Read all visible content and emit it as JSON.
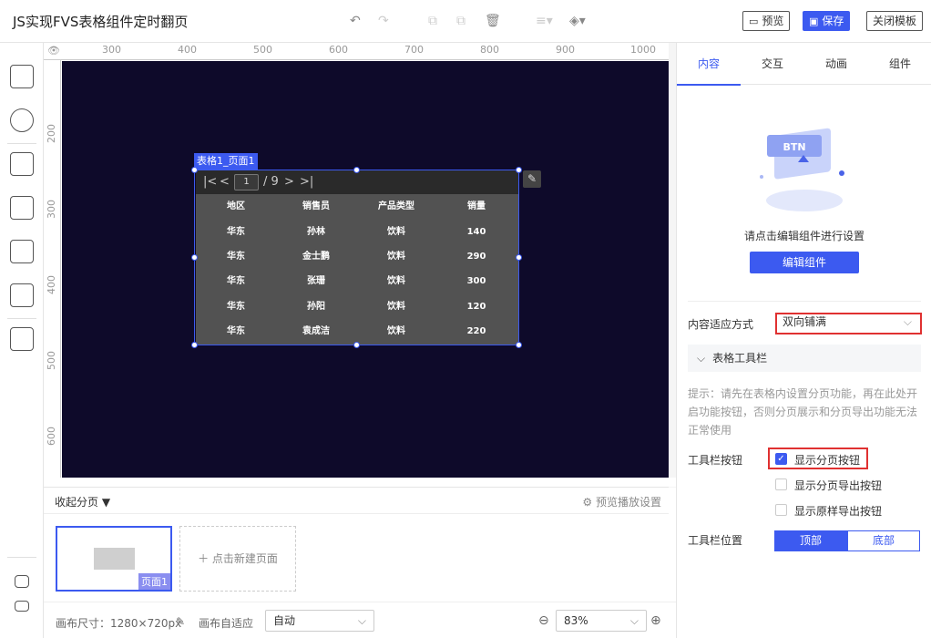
{
  "header": {
    "title": "JS实现FVS表格组件定时翻页",
    "undo_icon": "↶",
    "redo_icon": "↷",
    "preview_label": "预览",
    "save_label": "保存",
    "close_label": "关闭模板"
  },
  "ruler": {
    "h_ticks": [
      "300",
      "400",
      "500",
      "600",
      "700",
      "800",
      "900",
      "1000"
    ],
    "v_ticks": [
      "200",
      "300",
      "400",
      "500",
      "600"
    ]
  },
  "component": {
    "tag": "表格1_页面1",
    "page_current": "1",
    "page_total": "/ 9",
    "columns": [
      "地区",
      "销售员",
      "产品类型",
      "销量"
    ],
    "rows": [
      [
        "华东",
        "孙林",
        "饮料",
        "140"
      ],
      [
        "华东",
        "金士鹏",
        "饮料",
        "290"
      ],
      [
        "华东",
        "张珊",
        "饮料",
        "300"
      ],
      [
        "华东",
        "孙阳",
        "饮料",
        "120"
      ],
      [
        "华东",
        "袁成洁",
        "饮料",
        "220"
      ]
    ]
  },
  "pages": {
    "collapse_label": "收起分页",
    "playback_settings": "预览播放设置",
    "page1_label": "页面1",
    "new_page_label": "点击新建页面"
  },
  "footer": {
    "canvas_size": "画布尺寸：1280×720px",
    "canvas_fit_label": "画布自适应",
    "canvas_fit_value": "自动",
    "zoom_value": "83%"
  },
  "panel": {
    "tabs": [
      "内容",
      "交互",
      "动画",
      "组件"
    ],
    "hint": "请点击编辑组件进行设置",
    "edit_component": "编辑组件",
    "fit_label": "内容适应方式",
    "fit_value": "双向铺满",
    "toolbar_section": "表格工具栏",
    "tip": "提示：请先在表格内设置分页功能，再在此处开启功能按钮，否则分页展示和分页导出功能无法正常使用",
    "toolbar_buttons_label": "工具栏按钮",
    "opt_show_pager": "显示分页按钮",
    "opt_export_page": "显示分页导出按钮",
    "opt_export_original": "显示原样导出按钮",
    "toolbar_position_label": "工具栏位置",
    "pos_top": "顶部",
    "pos_bottom": "底部"
  },
  "colors": {
    "accent": "#3c5af0",
    "canvas_bg": "#0e0a2a",
    "highlight": "#e03131"
  }
}
